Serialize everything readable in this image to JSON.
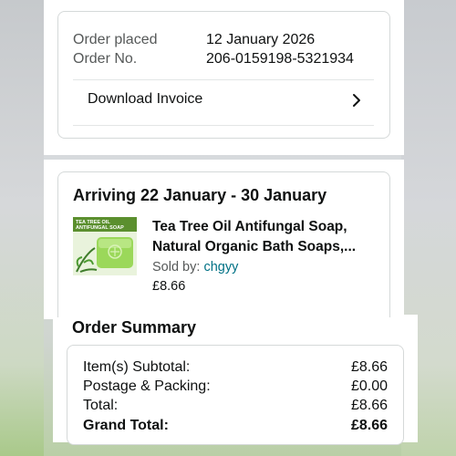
{
  "order": {
    "placed_label": "Order placed",
    "placed_value": "12 January 2026",
    "number_label": "Order No.",
    "number_value": "206-0159198-5321934",
    "download_invoice": "Download Invoice"
  },
  "shipment": {
    "arriving": "Arriving 22 January - 30 January",
    "product_title_line1": "Tea Tree Oil Antifungal Soap,",
    "product_title_line2": "Natural Organic Bath Soaps,...",
    "sold_by_label": "Sold by:",
    "seller": "chgyy",
    "price": "£8.66",
    "package_text_1": "TEA TREE OIL",
    "package_text_2": "ANTIFUNGAL SOAP"
  },
  "summary": {
    "title": "Order Summary",
    "rows": [
      {
        "label": "Item(s) Subtotal:",
        "value": "£8.66"
      },
      {
        "label": "Postage & Packing:",
        "value": "£0.00"
      },
      {
        "label": "Total:",
        "value": "£8.66"
      },
      {
        "label": "Grand Total:",
        "value": "£8.66"
      }
    ]
  },
  "colors": {
    "link": "#007185",
    "text": "#0f1111",
    "muted": "#565959",
    "product_green": "#8fd14f"
  }
}
